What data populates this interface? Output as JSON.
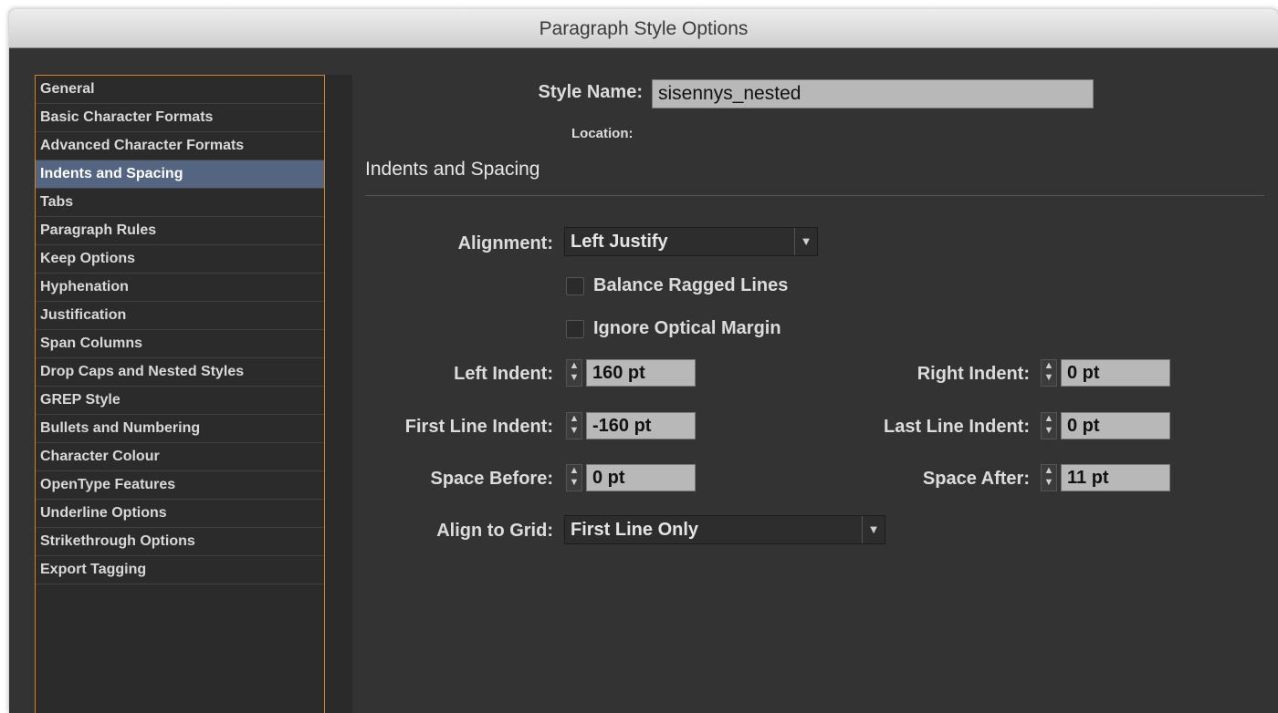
{
  "window": {
    "title": "Paragraph Style Options"
  },
  "categories": [
    {
      "label": "General"
    },
    {
      "label": "Basic Character Formats"
    },
    {
      "label": "Advanced Character Formats"
    },
    {
      "label": "Indents and Spacing",
      "selected": true
    },
    {
      "label": "Tabs"
    },
    {
      "label": "Paragraph Rules"
    },
    {
      "label": "Keep Options"
    },
    {
      "label": "Hyphenation"
    },
    {
      "label": "Justification"
    },
    {
      "label": "Span Columns"
    },
    {
      "label": "Drop Caps and Nested Styles"
    },
    {
      "label": "GREP Style"
    },
    {
      "label": "Bullets and Numbering"
    },
    {
      "label": "Character Colour"
    },
    {
      "label": "OpenType Features"
    },
    {
      "label": "Underline Options"
    },
    {
      "label": "Strikethrough Options"
    },
    {
      "label": "Export Tagging"
    }
  ],
  "style_name": {
    "label": "Style Name:",
    "value": "sisennys_nested"
  },
  "location": {
    "label": "Location:"
  },
  "section": {
    "title": "Indents and Spacing"
  },
  "alignment": {
    "label": "Alignment:",
    "value": "Left Justify"
  },
  "balance_ragged": {
    "label": "Balance Ragged Lines",
    "checked": false
  },
  "ignore_optical": {
    "label": "Ignore Optical Margin",
    "checked": false
  },
  "left_indent": {
    "label": "Left Indent:",
    "value": "160 pt"
  },
  "right_indent": {
    "label": "Right Indent:",
    "value": "0 pt"
  },
  "first_line_indent": {
    "label": "First Line Indent:",
    "value": "-160 pt"
  },
  "last_line_indent": {
    "label": "Last Line Indent:",
    "value": "0 pt"
  },
  "space_before": {
    "label": "Space Before:",
    "value": "0 pt"
  },
  "space_after": {
    "label": "Space After:",
    "value": "11 pt"
  },
  "align_to_grid": {
    "label": "Align to Grid:",
    "value": "First Line Only"
  },
  "icons": {
    "up": "spinner-up-icon",
    "down": "spinner-down-icon",
    "dropdown": "dropdown-arrow-icon"
  }
}
